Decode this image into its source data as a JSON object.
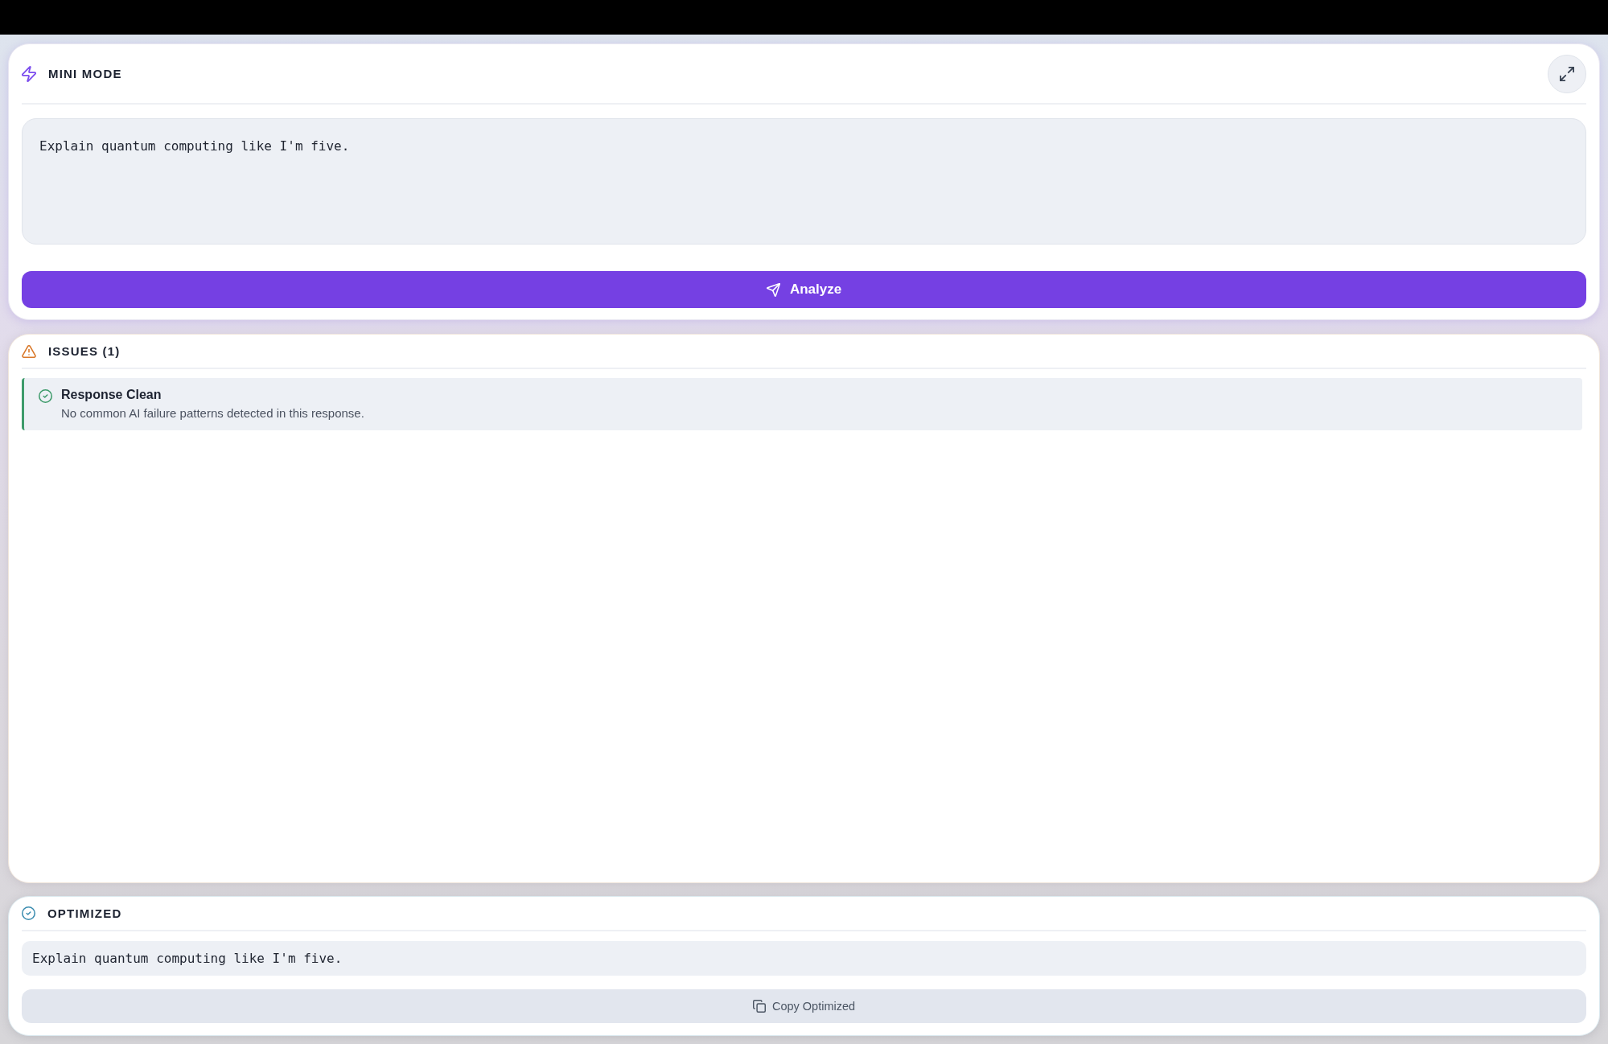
{
  "mini_mode": {
    "title": "MINI MODE",
    "prompt": {
      "value": "Explain quantum computing like I'm five."
    },
    "analyze_button": {
      "label": "Analyze"
    }
  },
  "issues": {
    "title": "ISSUES (1)",
    "items": [
      {
        "kind": "clean",
        "title": "Response Clean",
        "description": "No common AI failure patterns detected in this response."
      }
    ]
  },
  "optimized": {
    "title": "OPTIMIZED",
    "text": "Explain quantum computing like I'm five.",
    "copy_button": {
      "label": "Copy Optimized"
    }
  }
}
